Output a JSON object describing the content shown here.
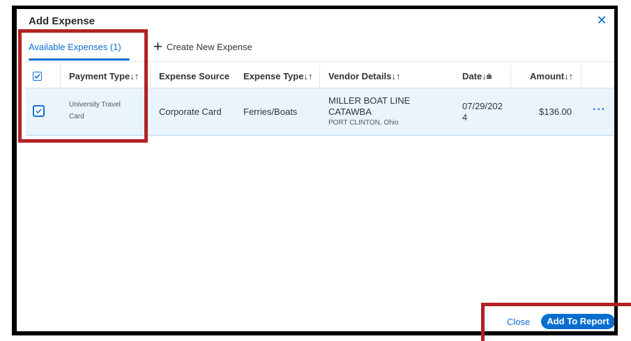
{
  "dialog": {
    "title": "Add Expense",
    "close_icon": "close-icon"
  },
  "tabs": {
    "available": "Available Expenses (1)",
    "create": "Create New Expense"
  },
  "table": {
    "headers": {
      "payment_type": "Payment Type",
      "expense_source": "Expense Source",
      "expense_type": "Expense Type",
      "vendor_details": "Vendor Details",
      "date": "Date",
      "amount": "Amount"
    },
    "sort_glyph": "↓↑",
    "date_sort_glyph": "↓⩧",
    "rows": [
      {
        "selected": true,
        "payment_type_line1": "University Travel",
        "payment_type_line2": "Card",
        "expense_source": "Corporate Card",
        "expense_type": "Ferries/Boats",
        "vendor_line1": "MILLER BOAT LINE",
        "vendor_line2": "CATAWBA",
        "vendor_location": "PORT CLINTON, Ohio",
        "date_line1": "07/29/202",
        "date_line2": "4",
        "amount": "$136.00",
        "more": "···"
      }
    ]
  },
  "footer": {
    "close_label": "Close",
    "add_label": "Add To Report"
  },
  "colors": {
    "accent": "#0a6ed1",
    "selected_row": "#eaf4fd",
    "annotation": "#b22222"
  }
}
